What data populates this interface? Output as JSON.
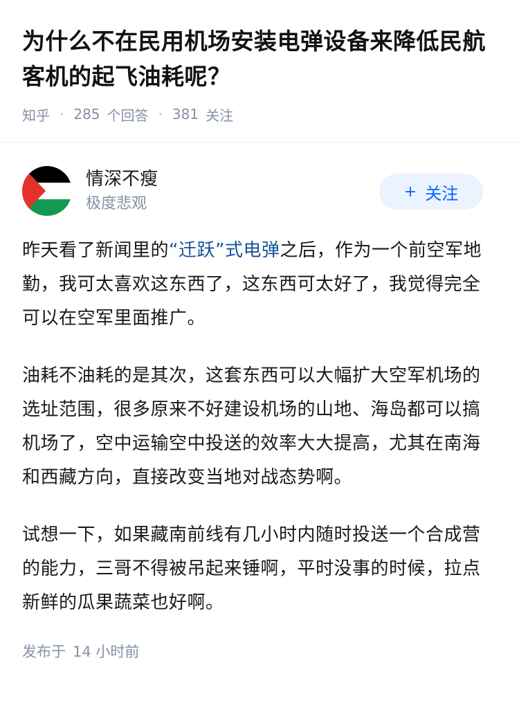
{
  "question": {
    "title": "为什么不在民用机场安装电弹设备来降低民航客机的起飞油耗呢？",
    "source": "知乎",
    "answer_count": "285",
    "answer_label": "个回答",
    "follow_count": "381",
    "follow_label": "关注"
  },
  "author": {
    "name": "情深不瘦",
    "bio": "极度悲观",
    "follow_button": "关注",
    "follow_icon": "+"
  },
  "answer": {
    "p1_before": "昨天看了新闻里的",
    "p1_link": "“迁跃”式电弹",
    "p1_after": "之后，作为一个前空军地勤，我可太喜欢这东西了，这东西可太好了，我觉得完全可以在空军里面推广。",
    "p2": "油耗不油耗的是其次，这套东西可以大幅扩大空军机场的选址范围，很多原来不好建设机场的山地、海岛都可以搞机场了，空中运输空中投送的效率大大提高，尤其在南海和西藏方向，直接改变当地对战态势啊。",
    "p3": "试想一下，如果藏南前线有几小时内随时投送一个合成营的能力，三哥不得被吊起来锤啊，平时没事的时候，拉点新鲜的瓜果蔬菜也好啊。"
  },
  "publish": {
    "label": "发布于",
    "time": "14 小时前"
  },
  "colors": {
    "link": "#175199",
    "accent": "#0066ff",
    "meta": "#8590a6",
    "flag_black": "#000000",
    "flag_white": "#ffffff",
    "flag_green": "#149954",
    "flag_red": "#e4312b"
  }
}
